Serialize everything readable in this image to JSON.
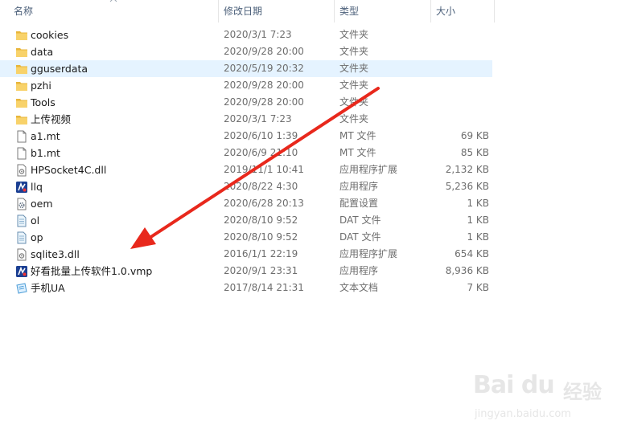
{
  "columns": {
    "name": "名称",
    "date": "修改日期",
    "type": "类型",
    "size": "大小"
  },
  "files": [
    {
      "icon": "folder-icon",
      "name": "cookies",
      "date": "2020/3/1 7:23",
      "type": "文件夹",
      "size": "",
      "selected": false
    },
    {
      "icon": "folder-icon",
      "name": "data",
      "date": "2020/9/28 20:00",
      "type": "文件夹",
      "size": "",
      "selected": false
    },
    {
      "icon": "folder-icon",
      "name": "gguserdata",
      "date": "2020/5/19 20:32",
      "type": "文件夹",
      "size": "",
      "selected": true
    },
    {
      "icon": "folder-icon",
      "name": "pzhi",
      "date": "2020/9/28 20:00",
      "type": "文件夹",
      "size": "",
      "selected": false
    },
    {
      "icon": "folder-icon",
      "name": "Tools",
      "date": "2020/9/28 20:00",
      "type": "文件夹",
      "size": "",
      "selected": false
    },
    {
      "icon": "folder-icon",
      "name": "上传视频",
      "date": "2020/3/1 7:23",
      "type": "文件夹",
      "size": "",
      "selected": false
    },
    {
      "icon": "blank-file-icon",
      "name": "a1.mt",
      "date": "2020/6/10 1:39",
      "type": "MT 文件",
      "size": "69 KB",
      "selected": false
    },
    {
      "icon": "blank-file-icon",
      "name": "b1.mt",
      "date": "2020/6/9 21:10",
      "type": "MT 文件",
      "size": "85 KB",
      "selected": false
    },
    {
      "icon": "dll-file-icon",
      "name": "HPSocket4C.dll",
      "date": "2019/11/1 10:41",
      "type": "应用程序扩展",
      "size": "2,132 KB",
      "selected": false
    },
    {
      "icon": "app-icon",
      "name": "llq",
      "date": "2020/8/22 4:30",
      "type": "应用程序",
      "size": "5,236 KB",
      "selected": false
    },
    {
      "icon": "settings-file-icon",
      "name": "oem",
      "date": "2020/6/28 20:13",
      "type": "配置设置",
      "size": "1 KB",
      "selected": false
    },
    {
      "icon": "dat-file-icon",
      "name": "ol",
      "date": "2020/8/10 9:52",
      "type": "DAT 文件",
      "size": "1 KB",
      "selected": false
    },
    {
      "icon": "dat-file-icon",
      "name": "op",
      "date": "2020/8/10 9:52",
      "type": "DAT 文件",
      "size": "1 KB",
      "selected": false
    },
    {
      "icon": "dll-file-icon",
      "name": "sqlite3.dll",
      "date": "2016/1/1 22:19",
      "type": "应用程序扩展",
      "size": "654 KB",
      "selected": false
    },
    {
      "icon": "app-icon",
      "name": "好看批量上传软件1.0.vmp",
      "date": "2020/9/1 23:31",
      "type": "应用程序",
      "size": "8,936 KB",
      "selected": false
    },
    {
      "icon": "text-file-icon",
      "name": "手机UA",
      "date": "2017/8/14 21:31",
      "type": "文本文档",
      "size": "7 KB",
      "selected": false
    }
  ],
  "colors": {
    "folder": "#f5c242",
    "selected_row": "#e5f3ff",
    "arrow": "#e8281c"
  },
  "watermark": {
    "logo": "Bai  du",
    "cn": "经验",
    "url": "jingyan.baidu.com"
  }
}
